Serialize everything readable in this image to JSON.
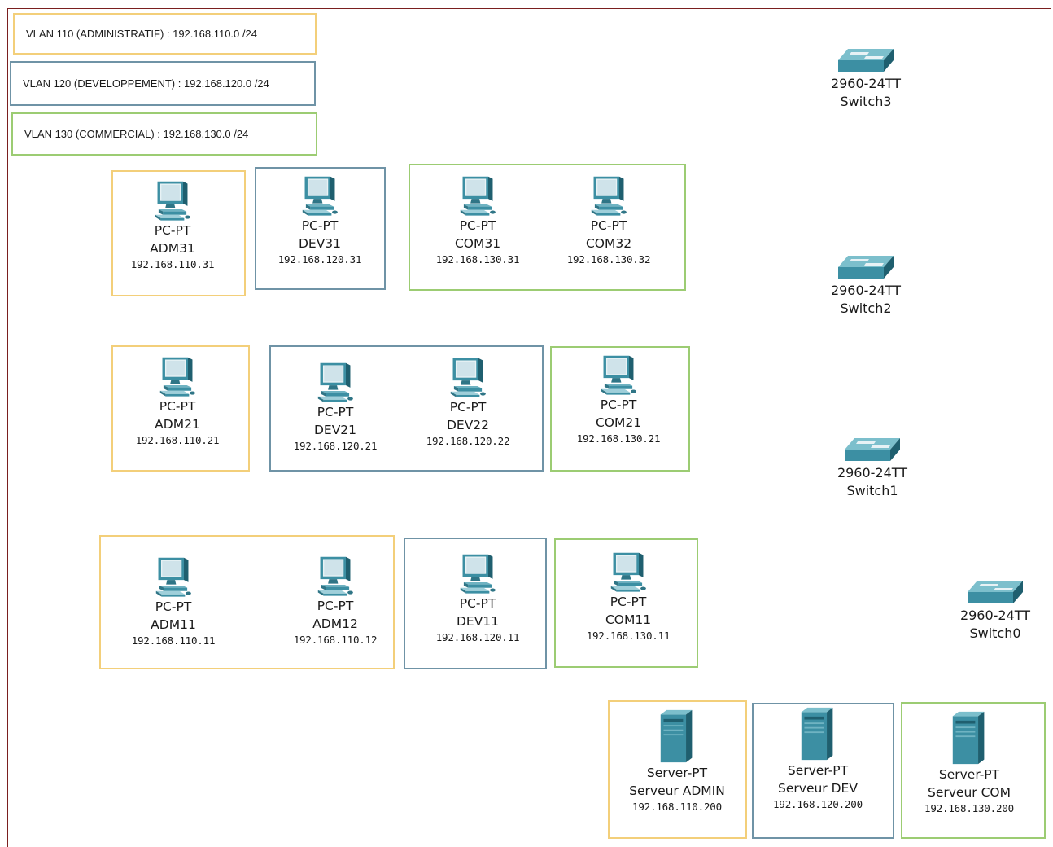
{
  "colors": {
    "administratif": "#f3cf7a",
    "developpement": "#6f93a6",
    "commercial": "#9ccc73",
    "device": "#3c8fa3"
  },
  "legend": [
    {
      "label": "VLAN 110 (ADMINISTRATIF) : 192.168.110.0 /24"
    },
    {
      "label": "VLAN 120 (DEVELOPPEMENT) : 192.168.120.0 /24"
    },
    {
      "label": "VLAN 130 (COMMERCIAL) : 192.168.130.0 /24"
    }
  ],
  "switches": [
    {
      "model": "2960-24TT",
      "name": "Switch3"
    },
    {
      "model": "2960-24TT",
      "name": "Switch2"
    },
    {
      "model": "2960-24TT",
      "name": "Switch1"
    },
    {
      "model": "2960-24TT",
      "name": "Switch0"
    }
  ],
  "pcs": {
    "adm31": {
      "type": "PC-PT",
      "name": "ADM31",
      "ip": "192.168.110.31"
    },
    "dev31": {
      "type": "PC-PT",
      "name": "DEV31",
      "ip": "192.168.120.31"
    },
    "com31": {
      "type": "PC-PT",
      "name": "COM31",
      "ip": "192.168.130.31"
    },
    "com32": {
      "type": "PC-PT",
      "name": "COM32",
      "ip": "192.168.130.32"
    },
    "adm21": {
      "type": "PC-PT",
      "name": "ADM21",
      "ip": "192.168.110.21"
    },
    "dev21": {
      "type": "PC-PT",
      "name": "DEV21",
      "ip": "192.168.120.21"
    },
    "dev22": {
      "type": "PC-PT",
      "name": "DEV22",
      "ip": "192.168.120.22"
    },
    "com21": {
      "type": "PC-PT",
      "name": "COM21",
      "ip": "192.168.130.21"
    },
    "adm11": {
      "type": "PC-PT",
      "name": "ADM11",
      "ip": "192.168.110.11"
    },
    "adm12": {
      "type": "PC-PT",
      "name": "ADM12",
      "ip": "192.168.110.12"
    },
    "dev11": {
      "type": "PC-PT",
      "name": "DEV11",
      "ip": "192.168.120.11"
    },
    "com11": {
      "type": "PC-PT",
      "name": "COM11",
      "ip": "192.168.130.11"
    }
  },
  "servers": {
    "admin": {
      "type": "Server-PT",
      "name": "Serveur ADMIN",
      "ip": "192.168.110.200"
    },
    "dev": {
      "type": "Server-PT",
      "name": "Serveur DEV",
      "ip": "192.168.120.200"
    },
    "com": {
      "type": "Server-PT",
      "name": "Serveur COM",
      "ip": "192.168.130.200"
    }
  }
}
